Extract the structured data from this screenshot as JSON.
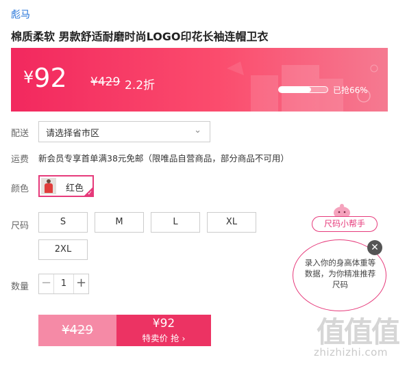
{
  "product": {
    "brand": "彪马",
    "title": "棉质柔软 男款舒适耐磨时尚LOGO印花长袖连帽卫衣"
  },
  "banner": {
    "currency": "¥",
    "price": "92",
    "original_price": "¥429",
    "discount": "2.2折",
    "sold_text": "已抢66%",
    "sold_percent": 66,
    "colors": {
      "start": "#f2285e",
      "end": "#f57a91"
    }
  },
  "delivery": {
    "label": "配送",
    "select_value": "请选择省市区"
  },
  "shipping": {
    "label": "运费",
    "text": "新会员专享首单满38元免邮（限唯品自营商品，部分商品不可用）"
  },
  "color": {
    "label": "颜色",
    "selected": "红色"
  },
  "size": {
    "label": "尺码",
    "options": [
      "S",
      "M",
      "L",
      "XL",
      "2XL"
    ]
  },
  "quantity": {
    "label": "数量",
    "minus": "−",
    "value": "1",
    "plus": "+"
  },
  "buy": {
    "original_price": "¥429",
    "price": "¥92",
    "label": "特卖价 抢 ›",
    "accent": "#ec3363"
  },
  "size_helper": {
    "tag": "尺码小帮手",
    "text": "录入你的身高体重等数据，为你精准推荐尺码",
    "close": "✕"
  },
  "watermark": {
    "logo": "值值值",
    "text": "zhizhizhi.com"
  }
}
